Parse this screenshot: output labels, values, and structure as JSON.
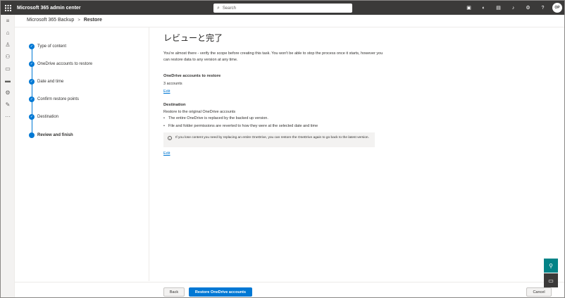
{
  "topbar": {
    "app_title": "Microsoft 365 admin center",
    "search_placeholder": "Search",
    "avatar_initials": "OP",
    "icons": [
      "terminal-icon",
      "sync-icon",
      "document-icon",
      "bell-icon",
      "gear-icon",
      "help-icon"
    ]
  },
  "breadcrumb": {
    "parent": "Microsoft 365 Backup",
    "separator": ">",
    "current": "Restore"
  },
  "steps": [
    {
      "label": "Type of content",
      "done": true
    },
    {
      "label": "OneDrive accounts to restore",
      "done": true
    },
    {
      "label": "Date and time",
      "done": true
    },
    {
      "label": "Confirm restore points",
      "done": true
    },
    {
      "label": "Destination",
      "done": true
    },
    {
      "label": "Review and finish",
      "current": true
    }
  ],
  "main": {
    "heading": "レビューと完了",
    "intro": "You're almost there - verify the scope before creating this task. You won't be able to stop the process once it starts, however you can restore data to any version at any time.",
    "accounts_title": "OneDrive accounts to restore",
    "accounts_value": "3 accounts",
    "edit_label": "Edit",
    "destination_title": "Destination",
    "destination_value": "Restore to the original OneDrive accounts",
    "bullets": [
      "The entire OneDrive is replaced by the backed up version.",
      "File and folder permissions are reverted to how they were at the selected date and time"
    ],
    "info_text": "If you lose content you need by replacing an entire OneDrive, you can restore the OneDrive again to go back to the latest version.",
    "edit_label_2": "Edit"
  },
  "footer": {
    "back_label": "Back",
    "primary_label": "Restore OneDrive accounts",
    "cancel_label": "Cancel"
  },
  "colors": {
    "topbar": "#3b3a39",
    "accent": "#0078d4",
    "teal": "#038387"
  }
}
